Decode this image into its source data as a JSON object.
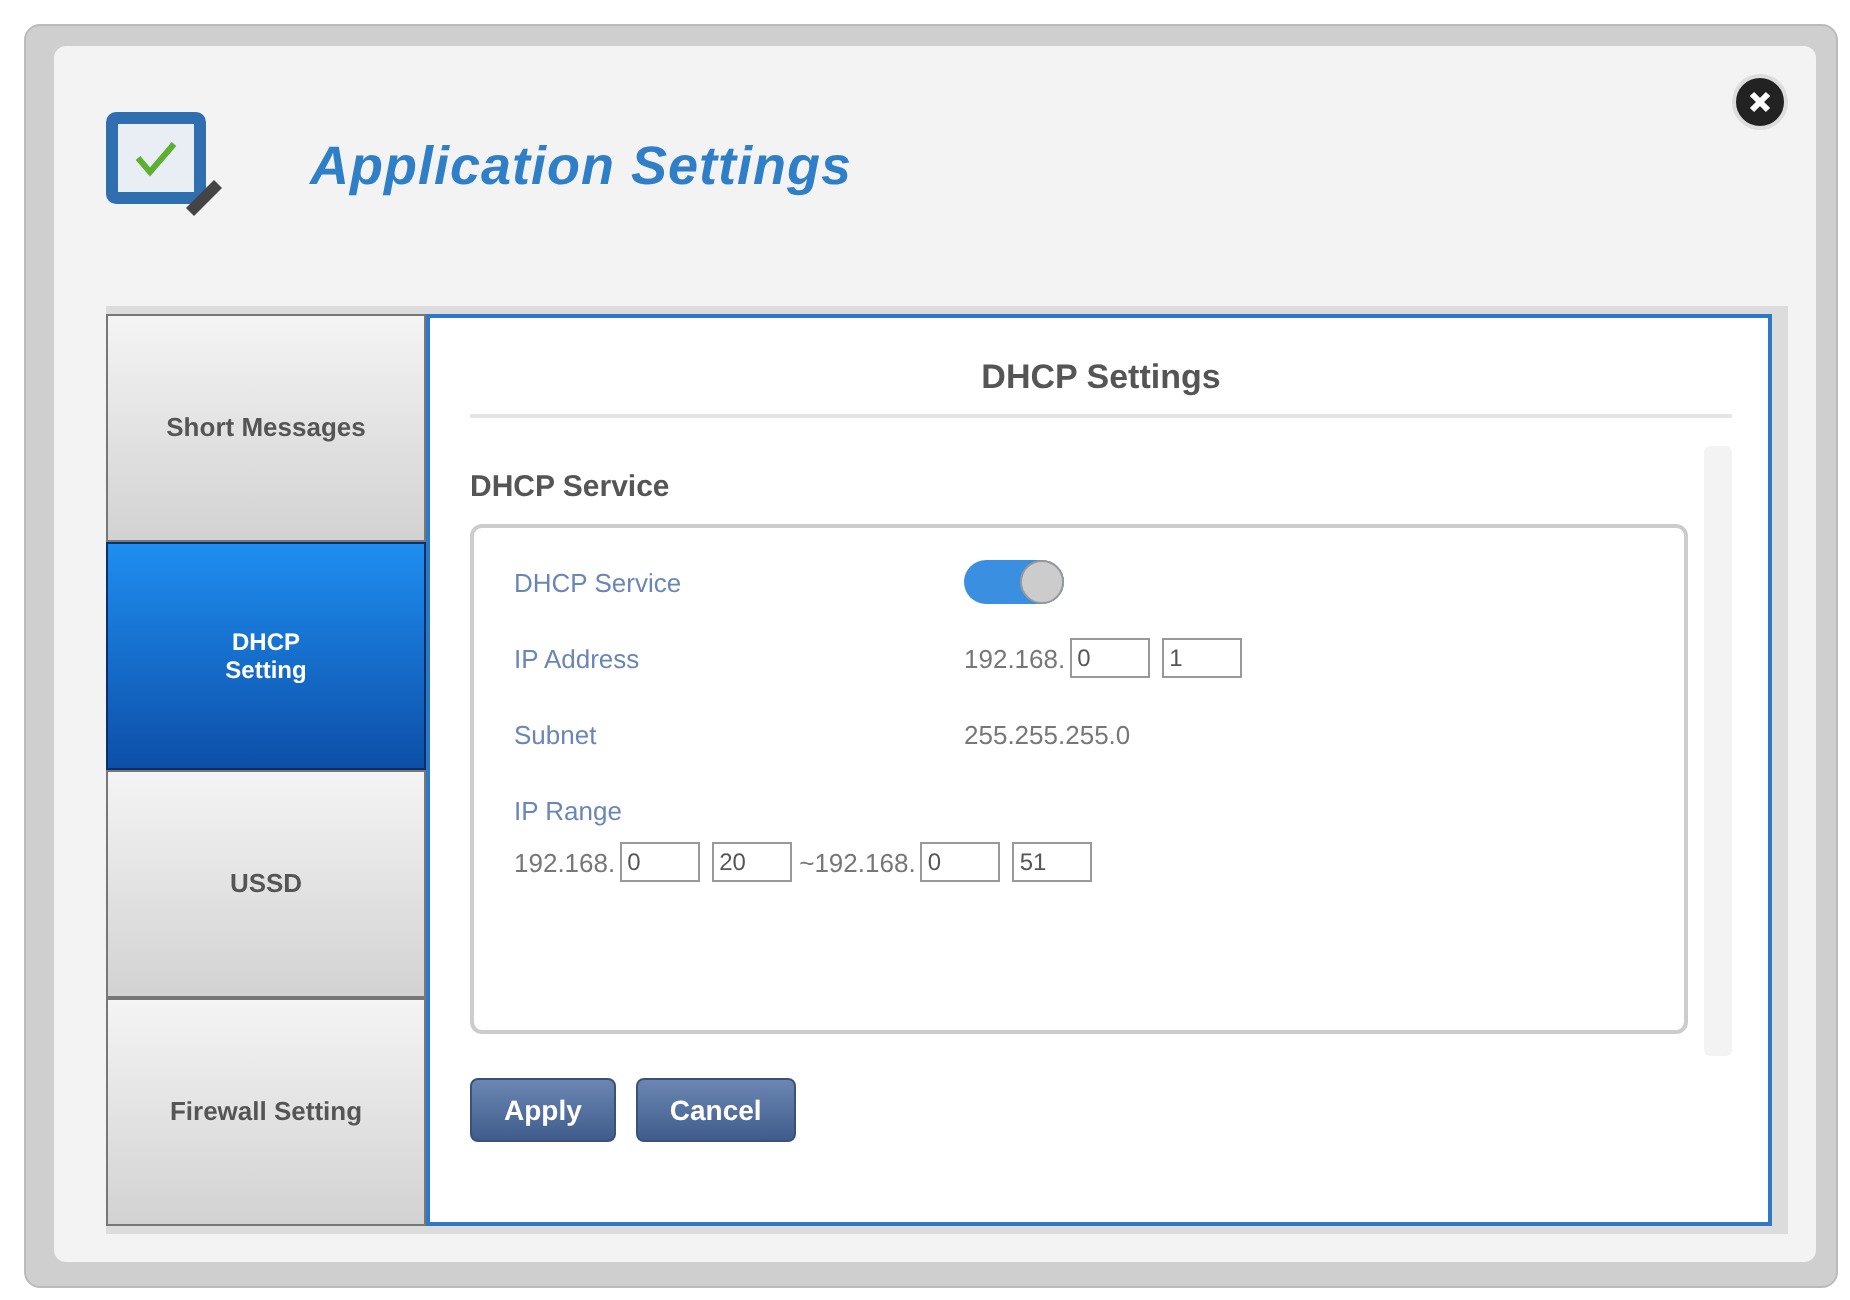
{
  "window": {
    "title": "Application Settings"
  },
  "tabs": [
    {
      "label": "Short Messages",
      "selected": false
    },
    {
      "label": "DHCP Setting",
      "selected": true
    },
    {
      "label": "USSD",
      "selected": false
    },
    {
      "label": "Firewall Setting",
      "selected": false
    }
  ],
  "panel": {
    "title": "DHCP Settings",
    "section": "DHCP Service",
    "service": {
      "label": "DHCP Service",
      "on": true
    },
    "ip_address": {
      "label": "IP Address",
      "prefix": "192.168.",
      "fields": [
        "0",
        "1"
      ]
    },
    "subnet": {
      "label": "Subnet",
      "value": "255.255.255.0"
    },
    "ip_range": {
      "label": "IP Range",
      "start_prefix": "192.168.",
      "start": [
        "0",
        "20"
      ],
      "separator": "~",
      "end_prefix": "192.168.",
      "end": [
        "0",
        "51"
      ]
    }
  },
  "buttons": [
    "Apply",
    "Cancel"
  ]
}
